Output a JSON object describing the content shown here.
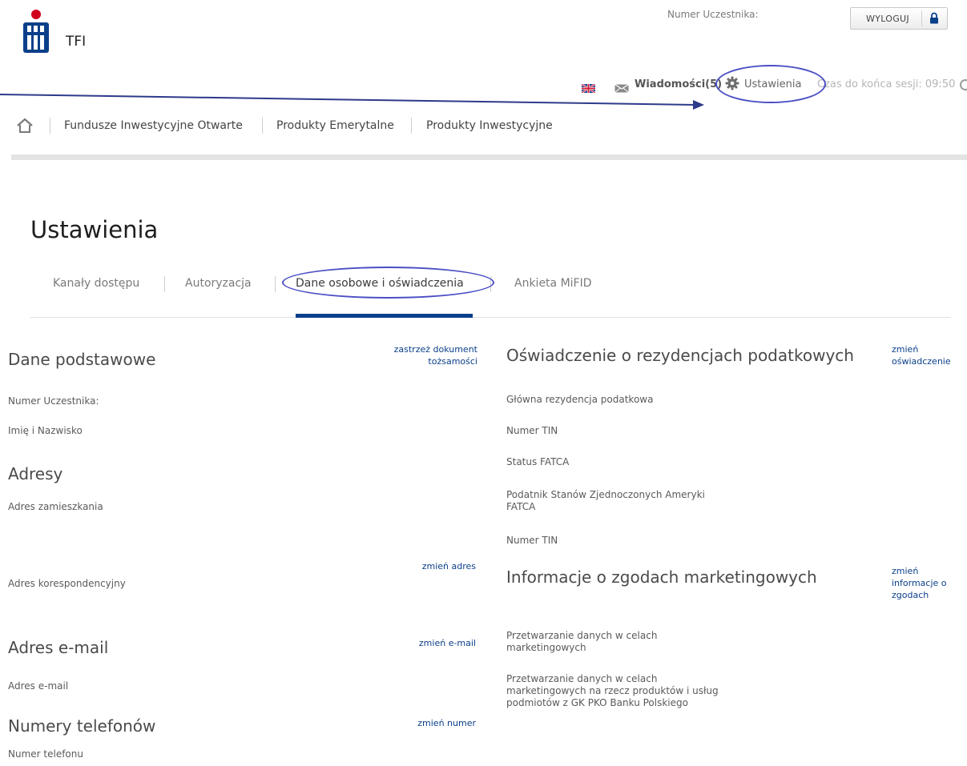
{
  "header": {
    "brand": "TFI",
    "participant_label": "Numer Uczestnika:",
    "logout_label": "WYLOGUJ",
    "messages_label": "Wiadomości(5)",
    "settings_label": "Ustawienia",
    "session_label": "Czas do końca sesji: 09:50"
  },
  "nav": {
    "items": [
      {
        "label": "Fundusze Inwestycyjne Otwarte"
      },
      {
        "label": "Produkty Emerytalne"
      },
      {
        "label": "Produkty Inwestycyjne"
      }
    ]
  },
  "page": {
    "title": "Ustawienia"
  },
  "tabs": [
    {
      "label": "Kanały dostępu"
    },
    {
      "label": "Autoryzacja"
    },
    {
      "label": "Dane osobowe i oświadczenia"
    },
    {
      "label": "Ankieta MiFID"
    }
  ],
  "left": {
    "basic_title": "Dane podstawowe",
    "basic_link": "zastrzeż dokument tożsamości",
    "participant_number": "Numer Uczestnika:",
    "full_name": "Imię i Nazwisko",
    "addresses_title": "Adresy",
    "residence_address": "Adres zamieszkania",
    "change_address_link": "zmień adres",
    "correspondence_address": "Adres korespondencyjny",
    "email_title": "Adres e-mail",
    "change_email_link": "zmień e-mail",
    "email_label": "Adres e-mail",
    "phones_title": "Numery telefonów",
    "change_number_link": "zmień numer",
    "phone_label": "Numer telefonu"
  },
  "right": {
    "tax_title": "Oświadczenie o rezydencjach podatkowych",
    "tax_link": "zmień oświadczenie",
    "main_residency": "Główna rezydencja podatkowa",
    "tin1": "Numer TIN",
    "fatca_status": "Status FATCA",
    "us_taxpayer": "Podatnik Stanów Zjednoczonych Ameryki FATCA",
    "tin2": "Numer TIN",
    "marketing_title": "Informacje o zgodach marketingowych",
    "marketing_link": "zmień informacje o zgodach",
    "consent1": "Przetwarzanie danych w celach marketingowych",
    "consent2": "Przetwarzanie danych w celach marketingowych na rzecz produktów i usług podmiotów z GK PKO Banku Polskiego"
  },
  "colors": {
    "brand_navy": "#0a3f8a",
    "brand_red": "#d0021b",
    "annotation_blue": "#4a4fc4",
    "active_tab": "#0a3f8a"
  },
  "icons": [
    "pko-logo-icon",
    "lock-icon",
    "uk-flag-icon",
    "envelope-icon",
    "gear-icon",
    "refresh-icon",
    "home-icon"
  ]
}
